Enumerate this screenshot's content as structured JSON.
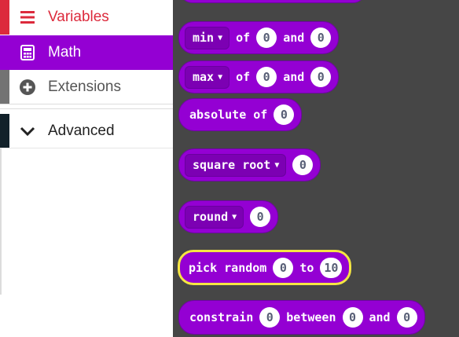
{
  "toolbox": {
    "variables": {
      "label": "Variables",
      "icon": "list-icon"
    },
    "math": {
      "label": "Math",
      "icon": "calculator-icon"
    },
    "extensions": {
      "label": "Extensions",
      "icon": "plus-circle-icon"
    },
    "advanced": {
      "label": "Advanced",
      "icon": "chevron-down-icon"
    }
  },
  "colors": {
    "variables": "#dc2a3c",
    "math": "#9400d3",
    "extensions": "#737373",
    "advanced": "#12212a",
    "flyout_bg": "#464646",
    "selection": "#f5e642"
  },
  "blocks": {
    "min": {
      "op": "min",
      "of": "of",
      "a": "0",
      "and": "and",
      "b": "0"
    },
    "max": {
      "op": "max",
      "of": "of",
      "a": "0",
      "and": "and",
      "b": "0"
    },
    "absolute": {
      "label": "absolute of",
      "value": "0"
    },
    "sqrt": {
      "op": "square root",
      "value": "0"
    },
    "round": {
      "op": "round",
      "value": "0"
    },
    "random": {
      "label": "pick random",
      "from": "0",
      "to_label": "to",
      "to": "10"
    },
    "constrain": {
      "label": "constrain",
      "value": "0",
      "between": "between",
      "low": "0",
      "and": "and",
      "high": "0"
    }
  }
}
